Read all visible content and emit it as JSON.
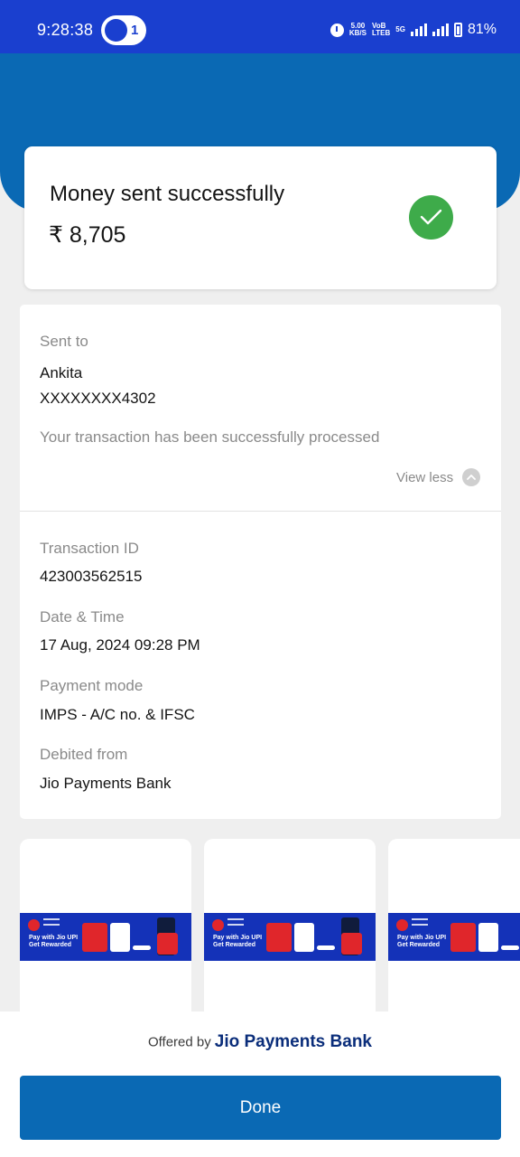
{
  "status_bar": {
    "time": "9:28:38",
    "hotspot_count": "1",
    "net_speed_value": "5.00",
    "net_speed_unit": "KB/S",
    "volte_top": "VoB",
    "volte_bottom": "LTEB",
    "network_type": "5G",
    "battery": "81%"
  },
  "success": {
    "title": "Money sent successfully",
    "amount": "₹ 8,705"
  },
  "details": {
    "sent_to_label": "Sent to",
    "recipient_name": "Ankita",
    "recipient_account": "XXXXXXXX4302",
    "status_note": "Your transaction has been successfully processed",
    "view_less": "View less",
    "transaction_id_label": "Transaction ID",
    "transaction_id": "423003562515",
    "date_time_label": "Date & Time",
    "date_time": "17 Aug, 2024 09:28 PM",
    "payment_mode_label": "Payment mode",
    "payment_mode": "IMPS - A/C no. & IFSC",
    "debited_from_label": "Debited from",
    "debited_from": "Jio Payments Bank"
  },
  "promo": {
    "banner_text_line1": "Pay with Jio UPI",
    "banner_text_line2": "Get Rewarded"
  },
  "footer": {
    "offered_by": "Offered by",
    "bank_name": "Jio Payments Bank",
    "done_label": "Done"
  },
  "colors": {
    "status_bar": "#1a3fcf",
    "header": "#0a69b4",
    "success_green": "#3eab4a",
    "done_button": "#0a69b4"
  }
}
